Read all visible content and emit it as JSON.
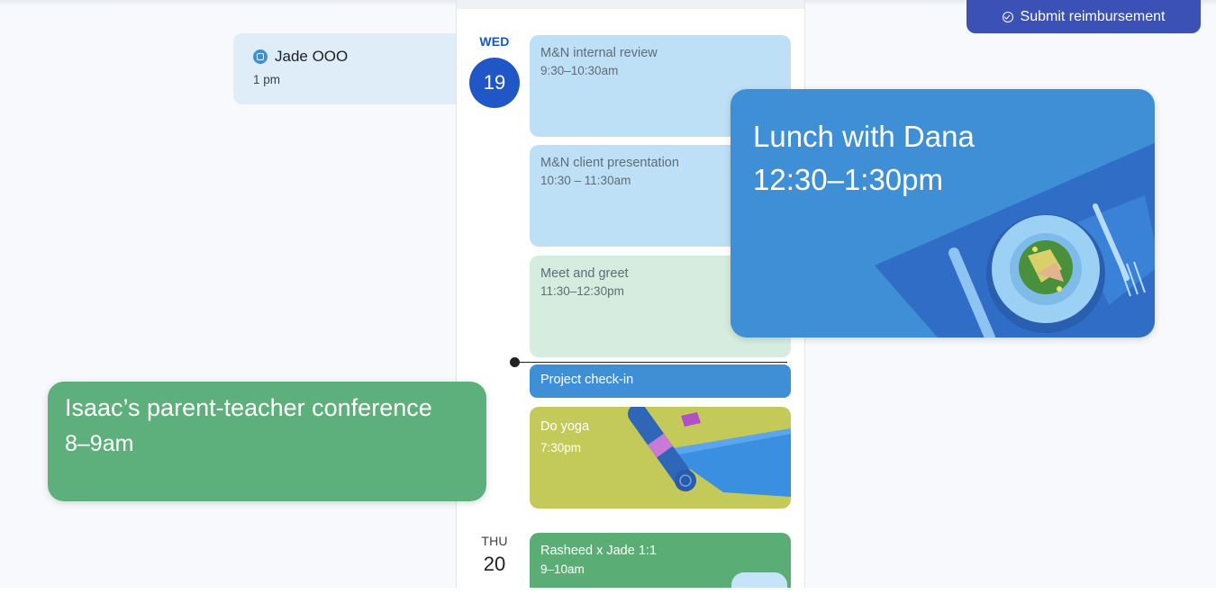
{
  "header": {
    "submit_label": "Submit reimbursement"
  },
  "out_of_office": {
    "title": "Jade OOO",
    "time": "1 pm"
  },
  "days": [
    {
      "dow": "WED",
      "date": "19"
    },
    {
      "dow": "THU",
      "date": "20"
    }
  ],
  "events": [
    {
      "title": "M&N internal review",
      "time": "9:30–10:30am"
    },
    {
      "title": "M&N client presentation",
      "time": "10:30 – 11:30am"
    },
    {
      "title": "Meet and greet",
      "time": "11:30–12:30pm"
    },
    {
      "title": "Project check-in"
    },
    {
      "title": "Do yoga",
      "time": "7:30pm"
    },
    {
      "title": "Rasheed x Jade 1:1",
      "time": "9–10am"
    }
  ],
  "popups": {
    "lunch": {
      "title": "Lunch with Dana",
      "time": "12:30–1:30pm"
    },
    "isaac": {
      "title": "Isaac’s parent-teacher conference",
      "time": "8–9am"
    }
  },
  "colors": {
    "primary": "#2156c7",
    "event_blue": "#bde0f6",
    "event_green": "#d6ecdf",
    "checkin": "#3f8fd6",
    "yoga": "#c3ca5a",
    "rasheed": "#5aae75",
    "submit": "#3c51b5",
    "isaac": "#5db07b"
  },
  "icons": [
    "calendar-icon",
    "check-circle-icon"
  ]
}
